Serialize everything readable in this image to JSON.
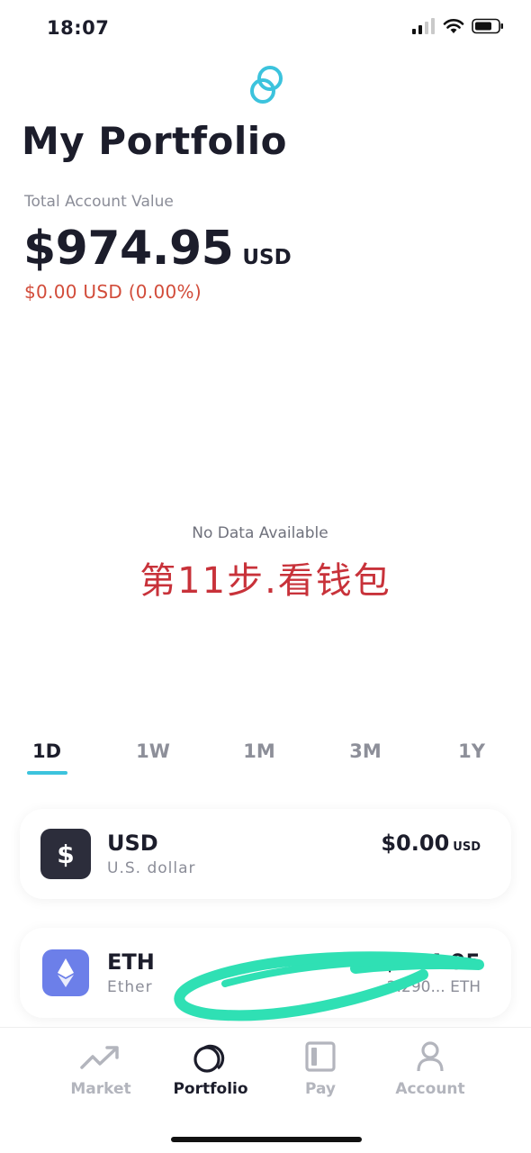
{
  "status_bar": {
    "time": "18:07"
  },
  "header": {
    "title": "My Portfolio"
  },
  "summary": {
    "label": "Total Account Value",
    "amount": "$974.95",
    "currency": "USD",
    "change": "$0.00 USD (0.00%)"
  },
  "chart": {
    "empty_message": "No Data Available",
    "annotation": "第11步.看钱包"
  },
  "ranges": [
    {
      "label": "1D",
      "active": true
    },
    {
      "label": "1W",
      "active": false
    },
    {
      "label": "1M",
      "active": false
    },
    {
      "label": "3M",
      "active": false
    },
    {
      "label": "1Y",
      "active": false
    }
  ],
  "assets": [
    {
      "icon": "dollar-icon",
      "code": "USD",
      "name": "U.S. dollar",
      "amount": "$0.00",
      "unit": "USD",
      "quantity": ""
    },
    {
      "icon": "ethereum-icon",
      "code": "ETH",
      "name": "Ether",
      "amount": "$974.95",
      "unit": "",
      "quantity": "2.290... ETH"
    }
  ],
  "tab_bar": [
    {
      "icon": "market-trend-icon",
      "label": "Market",
      "active": false
    },
    {
      "icon": "portfolio-coins-icon",
      "label": "Portfolio",
      "active": true
    },
    {
      "icon": "pay-card-icon",
      "label": "Pay",
      "active": false
    },
    {
      "icon": "account-person-icon",
      "label": "Account",
      "active": false
    }
  ],
  "colors": {
    "accent": "#3cc3dd",
    "negative": "#d24c3a",
    "annotation": "#c8323a",
    "scribble": "#2fe0b4",
    "eth": "#6c7fe9"
  }
}
